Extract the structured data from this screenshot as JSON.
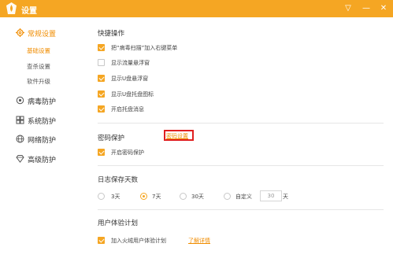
{
  "window": {
    "title": "设置",
    "accent": "#f5a623",
    "controls": {
      "dropdown": "▽",
      "minimize": "—",
      "close": "✕"
    }
  },
  "sidebar": {
    "items": [
      {
        "label": "常规设置",
        "icon": "gear-icon"
      },
      {
        "label": "病毒防护",
        "icon": "virus-shield-icon"
      },
      {
        "label": "系统防护",
        "icon": "system-icon"
      },
      {
        "label": "网络防护",
        "icon": "globe-icon"
      },
      {
        "label": "高级防护",
        "icon": "diamond-icon"
      }
    ],
    "subitems": [
      {
        "label": "基础设置"
      },
      {
        "label": "查杀设置"
      },
      {
        "label": "软件升级"
      }
    ]
  },
  "quick_ops": {
    "title": "快捷操作",
    "options": [
      {
        "label": "把“病毒扫描”加入右键菜单",
        "checked": true
      },
      {
        "label": "显示流量悬浮窗",
        "checked": false
      },
      {
        "label": "显示U盘悬浮窗",
        "checked": true
      },
      {
        "label": "显示U盘托盘图标",
        "checked": true
      },
      {
        "label": "开启托盘消息",
        "checked": true
      }
    ]
  },
  "password": {
    "title": "密码保护",
    "option": {
      "label": "开启密码保护",
      "checked": true
    },
    "link": "密码设置"
  },
  "log_days": {
    "title": "日志保存天数",
    "options": [
      {
        "label": "3天",
        "checked": false
      },
      {
        "label": "7天",
        "checked": true
      },
      {
        "label": "30天",
        "checked": false
      },
      {
        "label": "自定义",
        "checked": false
      }
    ],
    "custom_value": "30",
    "custom_unit": "天"
  },
  "ux_plan": {
    "title": "用户体验计划",
    "option": {
      "label": "加入火绒用户体验计划",
      "checked": true
    },
    "link": "了解详情"
  }
}
